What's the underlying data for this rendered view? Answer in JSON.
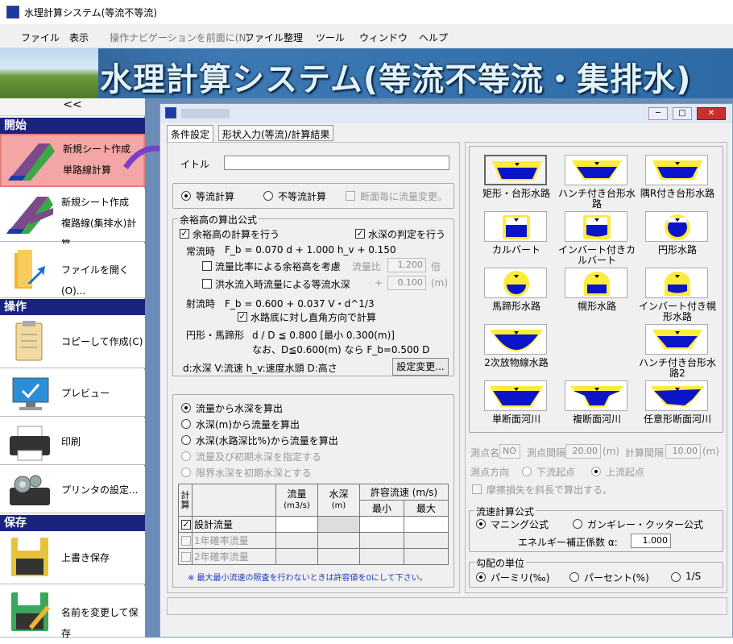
{
  "app": {
    "title": "水理計算システム(等流不等流)"
  },
  "menu": [
    "ファイル",
    "表示",
    "操作ナビゲーションを前面に(N)",
    "ファイル整理",
    "ツール",
    "ウィンドウ",
    "ヘルプ"
  ],
  "banner": {
    "text": "水理計算システム(等流不等流・集排水)"
  },
  "sidebar": {
    "collapse": "<<",
    "section_start": "開始",
    "new_single_1": "新規シート作成",
    "new_single_2": "単路線計算",
    "new_multi_1": "新規シート作成",
    "new_multi_2": "複路線(集排水)計算",
    "open_file": "ファイルを開く(O)...",
    "section_ops": "操作",
    "copy_create": "コピーして作成(C)",
    "preview": "プレビュー",
    "print": "印刷",
    "printer_settings": "プリンタの設定...",
    "section_save": "保存",
    "overwrite_save": "上書き保存",
    "save_as": "名前を変更して保存"
  },
  "window": {
    "tabs": [
      "条件設定",
      "形状入力(等流)/計算結果"
    ],
    "title_label": "イトル",
    "title_value": ""
  },
  "calc_mode": {
    "uniform": "等流計算",
    "nonuniform": "不等流計算",
    "section_change": "断面毎に流量変更。"
  },
  "freeboard": {
    "group": "余裕高の算出公式",
    "calc_freeboard": "余裕高の計算を行う",
    "water_depth_check": "水深の判定を行う",
    "normal_label": "常流時",
    "normal_formula": "F_b = 0.070 d + 1.000 h_v + 0.150",
    "flow_ratio_opt": "流量比率による余裕高を考慮",
    "flow_ratio_label": "流量比",
    "flow_ratio_value": "1.200",
    "flow_ratio_unit": "倍",
    "flood_opt": "洪水流入時流量による等流水深",
    "flood_plus": "+",
    "flood_value": "0.100",
    "flood_unit": "(m)",
    "super_label": "射流時",
    "super_formula": "F_b = 0.600 + 0.037 V・d^1/3",
    "perpendicular": "水路底に対し直角方向で計算",
    "circ_label": "円形・馬蹄形",
    "circ_formula": "d / D ≦ 0.800 [最小 0.300(m)]",
    "circ_note": "なお、D≦0.600(m) なら F_b=0.500 D",
    "legend": "d:水深 V:流速 h_v:速度水頭 D:高さ",
    "change_btn": "設定変更..."
  },
  "flow_mode": {
    "opts": [
      "流量から水深を算出",
      "水深(m)から流量を算出",
      "水深(水路深比%)から流量を算出",
      "流量及び初期水深を指定する",
      "限界水深を初期水深とする"
    ]
  },
  "flow_table": {
    "h_calc": "計算",
    "h_flow": "流量",
    "h_flow_unit": "(m3/s)",
    "h_depth": "水深",
    "h_depth_unit": "(m)",
    "h_vel": "許容流速 (m/s)",
    "h_min": "最小",
    "h_max": "最大",
    "rows": [
      "設計流量",
      "1年確率流量",
      "2年確率流量"
    ],
    "note": "※ 最大最小流速の照査を行わないときは許容値を0にして下さい。"
  },
  "channels": [
    {
      "label": "矩形・台形水路",
      "icon": "trapezoid-channel"
    },
    {
      "label": "ハンチ付き台形水路",
      "icon": "haunch-trapezoid-channel"
    },
    {
      "label": "隅R付き台形水路",
      "icon": "fillet-trapezoid-channel"
    },
    {
      "label": "カルバート",
      "icon": "culvert"
    },
    {
      "label": "インバート付きカルバート",
      "icon": "invert-culvert"
    },
    {
      "label": "円形水路",
      "icon": "circular-channel"
    },
    {
      "label": "馬蹄形水路",
      "icon": "horseshoe-channel"
    },
    {
      "label": "幌形水路",
      "icon": "hood-channel"
    },
    {
      "label": "インバート付き幌形水路",
      "icon": "invert-hood-channel"
    },
    {
      "label": "2次放物線水路",
      "icon": "parabolic-channel"
    },
    {
      "label": "ハンチ付き台形水路2",
      "icon": "haunch-trapezoid-channel-2"
    },
    {
      "label": "単断面河川",
      "icon": "single-section-river"
    },
    {
      "label": "複断面河川",
      "icon": "compound-section-river"
    },
    {
      "label": "任意形断面河川",
      "icon": "arbitrary-section-river"
    }
  ],
  "measure": {
    "point_name_label": "測点名",
    "point_name_value": "NO",
    "point_interval_label": "測点間隔",
    "point_interval_value": "20.00",
    "calc_interval_label": "計算間隔",
    "calc_interval_value": "10.00",
    "unit": "(m)",
    "direction_label": "測点方向",
    "downstream": "下流起点",
    "upstream": "上流起点",
    "friction": "摩擦損失を斜長で算出する。"
  },
  "formula": {
    "group": "流速計算公式",
    "manning": "マニング公式",
    "ganguillet": "ガンギレー・クッター公式",
    "energy_label": "エネルギー補正係数 α:",
    "energy_value": "1.000"
  },
  "slope": {
    "group": "勾配の単位",
    "permil": "パーミリ(‰)",
    "percent": "パーセント(%)",
    "ratio": "1/S"
  },
  "colors": {
    "sidebar_header": "#1a237e",
    "selected": "#f4a6a6",
    "water": "#0a14c8",
    "channel": "#ffeb3b"
  }
}
